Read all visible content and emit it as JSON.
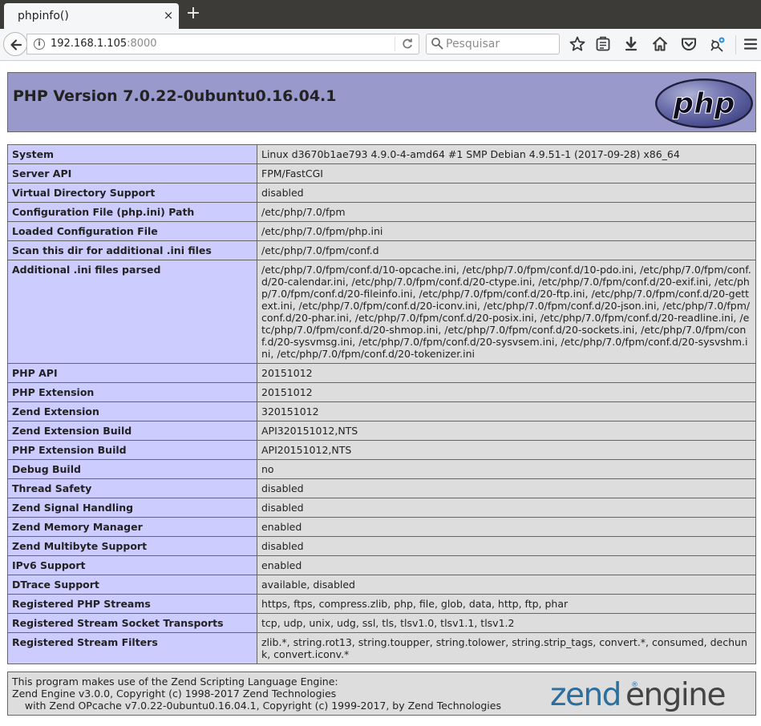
{
  "browser": {
    "tab_title": "phpinfo()",
    "tab_close": "×",
    "new_tab": "+",
    "url_host": "192.168.1.105",
    "url_port": ":8000",
    "search_placeholder": "Pesquisar"
  },
  "header": {
    "title": "PHP Version 7.0.22-0ubuntu0.16.04.1"
  },
  "logo_text": "php",
  "rows": [
    {
      "label": "System",
      "value": "Linux d3670b1ae793 4.9.0-4-amd64 #1 SMP Debian 4.9.51-1 (2017-09-28) x86_64"
    },
    {
      "label": "Server API",
      "value": "FPM/FastCGI"
    },
    {
      "label": "Virtual Directory Support",
      "value": "disabled"
    },
    {
      "label": "Configuration File (php.ini) Path",
      "value": "/etc/php/7.0/fpm"
    },
    {
      "label": "Loaded Configuration File",
      "value": "/etc/php/7.0/fpm/php.ini"
    },
    {
      "label": "Scan this dir for additional .ini files",
      "value": "/etc/php/7.0/fpm/conf.d"
    },
    {
      "label": "Additional .ini files parsed",
      "value": "/etc/php/7.0/fpm/conf.d/10-opcache.ini, /etc/php/7.0/fpm/conf.d/10-pdo.ini, /etc/php/7.0/fpm/conf.d/20-calendar.ini, /etc/php/7.0/fpm/conf.d/20-ctype.ini, /etc/php/7.0/fpm/conf.d/20-exif.ini, /etc/php/7.0/fpm/conf.d/20-fileinfo.ini, /etc/php/7.0/fpm/conf.d/20-ftp.ini, /etc/php/7.0/fpm/conf.d/20-gettext.ini, /etc/php/7.0/fpm/conf.d/20-iconv.ini, /etc/php/7.0/fpm/conf.d/20-json.ini, /etc/php/7.0/fpm/conf.d/20-phar.ini, /etc/php/7.0/fpm/conf.d/20-posix.ini, /etc/php/7.0/fpm/conf.d/20-readline.ini, /etc/php/7.0/fpm/conf.d/20-shmop.ini, /etc/php/7.0/fpm/conf.d/20-sockets.ini, /etc/php/7.0/fpm/conf.d/20-sysvmsg.ini, /etc/php/7.0/fpm/conf.d/20-sysvsem.ini, /etc/php/7.0/fpm/conf.d/20-sysvshm.ini, /etc/php/7.0/fpm/conf.d/20-tokenizer.ini"
    },
    {
      "label": "PHP API",
      "value": "20151012"
    },
    {
      "label": "PHP Extension",
      "value": "20151012"
    },
    {
      "label": "Zend Extension",
      "value": "320151012"
    },
    {
      "label": "Zend Extension Build",
      "value": "API320151012,NTS"
    },
    {
      "label": "PHP Extension Build",
      "value": "API20151012,NTS"
    },
    {
      "label": "Debug Build",
      "value": "no"
    },
    {
      "label": "Thread Safety",
      "value": "disabled"
    },
    {
      "label": "Zend Signal Handling",
      "value": "disabled"
    },
    {
      "label": "Zend Memory Manager",
      "value": "enabled"
    },
    {
      "label": "Zend Multibyte Support",
      "value": "disabled"
    },
    {
      "label": "IPv6 Support",
      "value": "enabled"
    },
    {
      "label": "DTrace Support",
      "value": "available, disabled"
    },
    {
      "label": "Registered PHP Streams",
      "value": "https, ftps, compress.zlib, php, file, glob, data, http, ftp, phar"
    },
    {
      "label": "Registered Stream Socket Transports",
      "value": "tcp, udp, unix, udg, ssl, tls, tlsv1.0, tlsv1.1, tlsv1.2"
    },
    {
      "label": "Registered Stream Filters",
      "value": "zlib.*, string.rot13, string.toupper, string.tolower, string.strip_tags, convert.*, consumed, dechunk, convert.iconv.*"
    }
  ],
  "footer": {
    "line1": "This program makes use of the Zend Scripting Language Engine:",
    "line2": "Zend Engine v3.0.0, Copyright (c) 1998-2017 Zend Technologies",
    "line3": "    with Zend OPcache v7.0.22-0ubuntu0.16.04.1, Copyright (c) 1999-2017, by Zend Technologies"
  },
  "zend_logo": {
    "word1": "zend",
    "word2": "engine"
  },
  "colors": {
    "header_bg": "#9999cc",
    "label_bg": "#ccccff",
    "value_bg": "#dddddd",
    "border": "#666666",
    "tab_bar": "#3c3b37",
    "zend_blue": "#2c6e9d"
  },
  "icons": [
    "back-arrow-icon",
    "info-icon",
    "reload-icon",
    "search-icon",
    "bookmark-star-icon",
    "reading-list-icon",
    "download-icon",
    "home-icon",
    "pocket-icon",
    "extension-icon",
    "hamburger-menu-icon"
  ]
}
